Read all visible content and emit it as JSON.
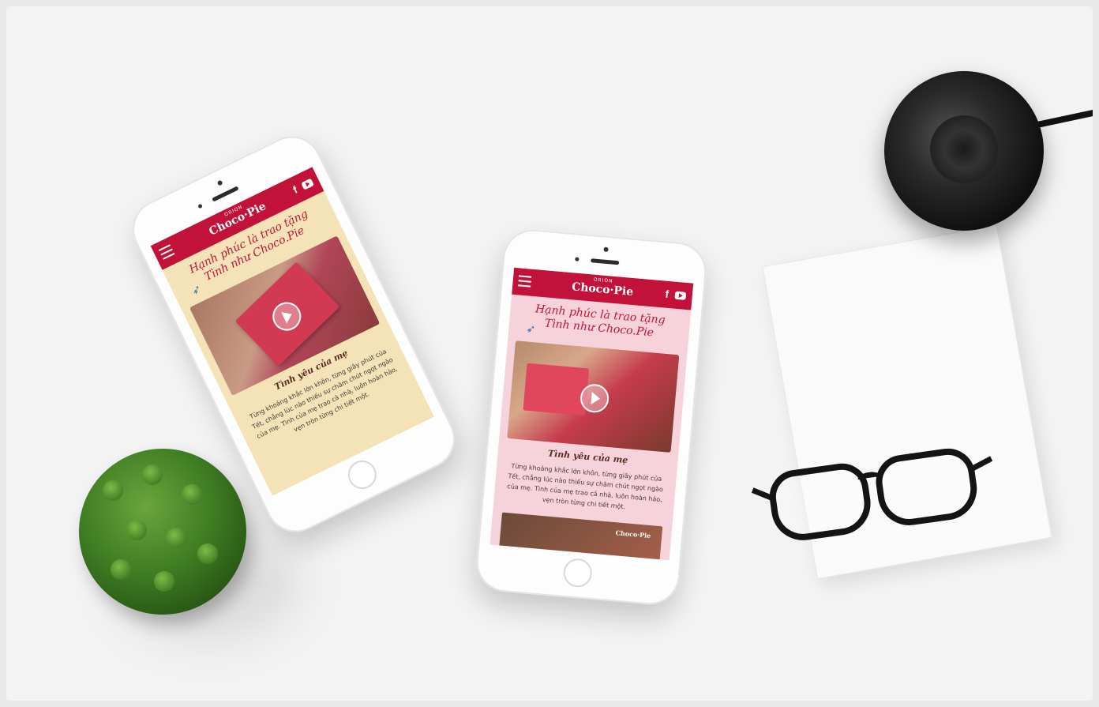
{
  "phones": [
    {
      "theme": "yellow",
      "brand_small": "ORION",
      "brand_main": "Choco·Pie",
      "social_fb": "f",
      "headline_line1": "Hạnh phúc là trao tặng",
      "headline_line2": "Tình như Choco.Pie",
      "subtitle": "Tình yêu của mẹ",
      "body": "Từng khoảng khắc lớn khôn, từng giây phút của Tết, chẳng lúc nào thiếu sự chăm chút ngọt ngào của mẹ. Tình của mẹ trao cả nhà, luôn hoàn hảo, vẹn tròn từng chi tiết một."
    },
    {
      "theme": "pink",
      "brand_small": "ORION",
      "brand_main": "Choco·Pie",
      "social_fb": "f",
      "headline_line1": "Hạnh phúc là trao tặng",
      "headline_line2": "Tình như Choco.Pie",
      "subtitle": "Tình yêu của mẹ",
      "body": "Từng khoảng khắc lớn khôn, từng giây phút của Tết, chẳng lúc nào thiếu sự chăm chút ngọt ngào của mẹ. Tình của mẹ trao cả nhà, luôn hoàn hảo, vẹn tròn từng chi tiết một.",
      "thumb_brand": "Choco·Pie"
    }
  ],
  "colors": {
    "brand_red": "#c3123a",
    "background": "#f3f3f3",
    "yellow_screen": "#f3e3b7",
    "pink_screen": "#f6d3da"
  }
}
